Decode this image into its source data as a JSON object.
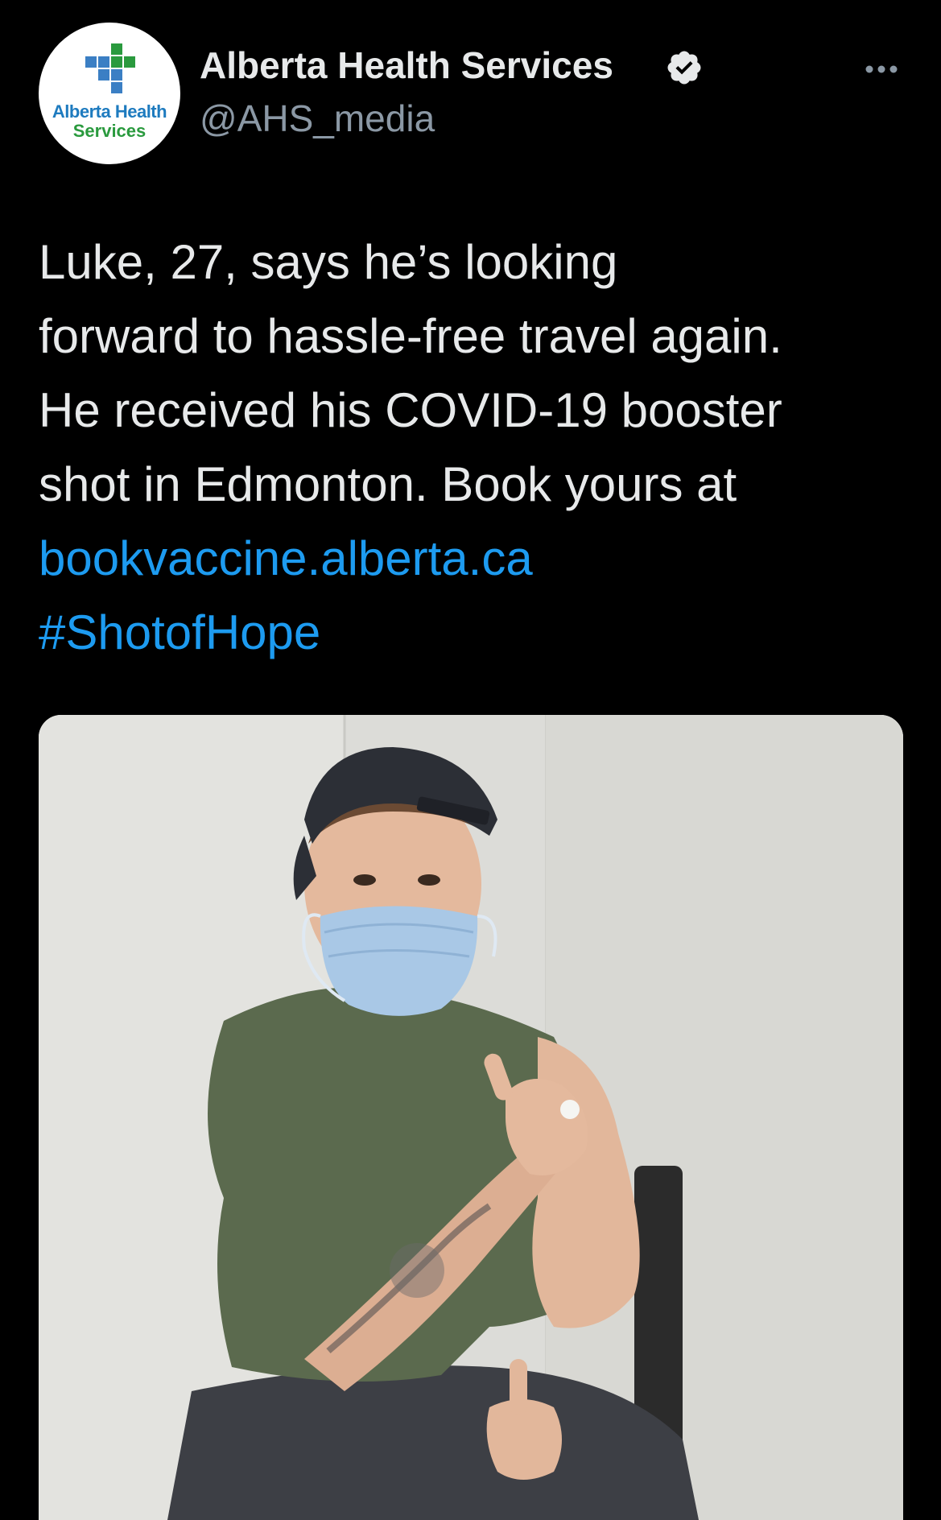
{
  "account": {
    "display_name": "Alberta Health Services",
    "handle": "@AHS_media",
    "verified": true,
    "avatar_logo_line1": "Alberta Health",
    "avatar_logo_line2": "Services"
  },
  "tweet": {
    "text_lines": [
      "Luke, 27, says he’s looking",
      "forward to hassle-free travel again.",
      "He received his COVID-19 booster",
      "shot in Edmonton. Book yours at"
    ],
    "link": "bookvaccine.alberta.ca",
    "hashtag": "#ShotofHope"
  },
  "icons": {
    "more": "more-horizontal-icon",
    "verified": "verified-badge-icon",
    "logo": "ahs-cross-logo-icon"
  },
  "colors": {
    "background": "#000000",
    "text": "#e7e9ea",
    "secondary_text": "#8b98a5",
    "link": "#1d9bf0",
    "logo_blue": "#1e7bbf",
    "logo_green": "#2a9a3e"
  }
}
